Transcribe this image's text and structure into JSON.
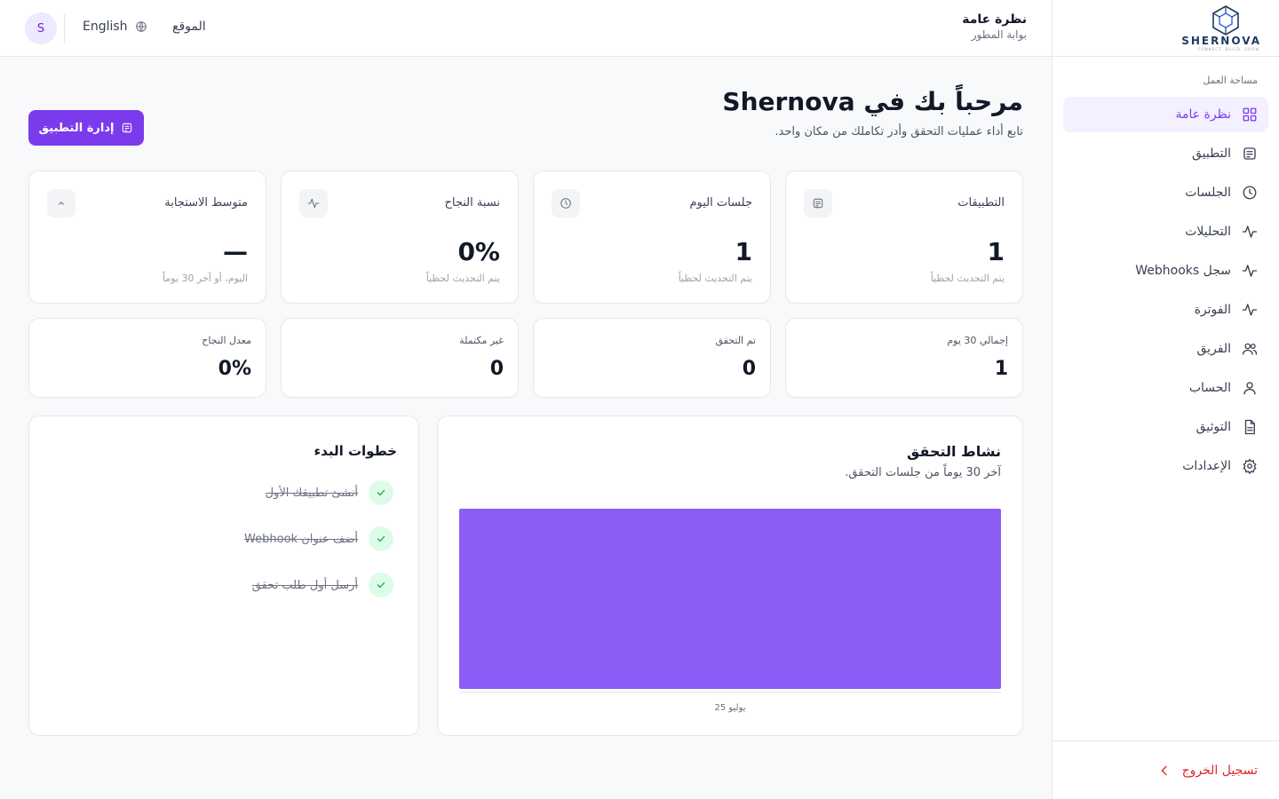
{
  "brand": {
    "name": "SHERNOVA",
    "tagline": "CONNECT. BUILD. GROW."
  },
  "header": {
    "title": "نظرة عامة",
    "subtitle": "بوابة المطور",
    "site_link": "الموقع",
    "language": "English",
    "avatar_initial": "S"
  },
  "sidebar": {
    "section_label": "مساحة العمل",
    "items": [
      {
        "label": "نظرة عامة",
        "icon": "grid-icon",
        "active": true
      },
      {
        "label": "التطبيق",
        "icon": "app-icon"
      },
      {
        "label": "الجلسات",
        "icon": "clock-icon"
      },
      {
        "label": "التحليلات",
        "icon": "activity-icon"
      },
      {
        "label": "سجل Webhooks",
        "icon": "activity-icon"
      },
      {
        "label": "الفوترة",
        "icon": "activity-icon"
      },
      {
        "label": "الفريق",
        "icon": "users-icon"
      },
      {
        "label": "الحساب",
        "icon": "user-icon"
      },
      {
        "label": "التوثيق",
        "icon": "document-icon"
      },
      {
        "label": "الإعدادات",
        "icon": "gear-icon"
      }
    ],
    "logout": "تسجيل الخروج"
  },
  "welcome": {
    "title": "مرحباً بك في Shernova",
    "subtitle": "تابع أداء عمليات التحقق وأدر تكاملك من مكان واحد."
  },
  "manage_button": "إدارة التطبيق",
  "stats": [
    {
      "title": "التطبيقات",
      "value": "1",
      "sub": "يتم التحديث لحظياً",
      "icon": "app-icon"
    },
    {
      "title": "جلسات اليوم",
      "value": "1",
      "sub": "يتم التحديث لحظياً",
      "icon": "clock-icon"
    },
    {
      "title": "نسبة النجاح",
      "value": "0%",
      "sub": "يتم التحديث لحظياً",
      "icon": "activity-icon"
    },
    {
      "title": "متوسط الاستجابة",
      "value": "—",
      "sub": "اليوم، أو آخر 30 يوماً",
      "icon": "arrow-up-icon"
    }
  ],
  "mini_stats": [
    {
      "title": "إجمالي 30 يوم",
      "value": "1"
    },
    {
      "title": "تم التحقق",
      "value": "0"
    },
    {
      "title": "غير مكتملة",
      "value": "0"
    },
    {
      "title": "معدل النجاح",
      "value": "0%"
    }
  ],
  "chart_data": {
    "type": "bar",
    "title": "نشاط التحقق",
    "subtitle": "آخر 30 يوماً من جلسات التحقق.",
    "categories": [
      "25 يوليو"
    ],
    "values": [
      1
    ],
    "ylim": [
      0,
      1
    ],
    "grid": false,
    "bar_color": "#8b5cf6"
  },
  "steps": {
    "title": "خطوات البدء",
    "items": [
      {
        "label": "أنشئ تطبيقك الأول",
        "done": true
      },
      {
        "label": "أضف عنوان Webhook",
        "done": true
      },
      {
        "label": "أرسل أول طلب تحقق",
        "done": true
      }
    ]
  },
  "colors": {
    "accent": "#7c3aed",
    "danger": "#dc2626",
    "success": "#16a34a"
  }
}
